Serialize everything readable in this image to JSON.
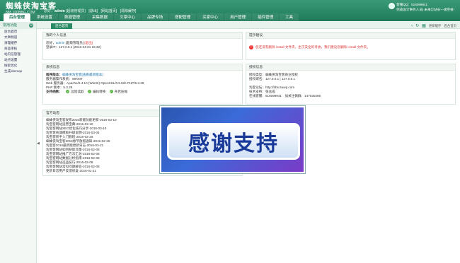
{
  "header": {
    "logo_title": "蜘蛛侠淘宝客",
    "logo_sub": "885.100BBG.COM",
    "welcome_prefix": "您好，",
    "username": "admin",
    "role": "[超级管理员]",
    "logout": "[退出]",
    "home": "[网站首页]",
    "clear_cache": "[清除缓存]"
  },
  "userbox": {
    "line1": "客服QQ：516099941",
    "line2": "完成设计事务人员| 未来订站长一级空投!"
  },
  "nav": {
    "tabs": [
      "后台管理",
      "系统设置",
      "数据管理",
      "采集数据",
      "文章中心",
      "品牌专场",
      "搭配管理",
      "买家中心",
      "用户管理",
      "插件管理",
      "工具"
    ]
  },
  "sidebar": {
    "title": "常用功能",
    "toggle": "⊖",
    "items": [
      "后台首页",
      "文章频道",
      "清理缓存",
      "商品审核",
      "站内信管理",
      "站点设置",
      "搜索优化",
      "生成sitemap"
    ]
  },
  "tabbar": {
    "current": "后台首页",
    "refresh": "更新缓存",
    "fullscreen": "后台首页"
  },
  "panels": {
    "info": {
      "title": "我的个人信息",
      "greeting": "您好，",
      "user": "admin",
      "role": "[超级管理员]",
      "logout": "[退出]",
      "login_ip": "登录IP：127.0.0.1 [2016-04-01 15:32]"
    },
    "tips": {
      "title": "提示建议",
      "warning": "您还没有删除 install 文件夹，出于安全的考虑，我们建议您删除 install 文件夹。"
    },
    "system": {
      "title": "系统信息",
      "program_label": "程序版本：",
      "program_value": "蜘蛛侠淘宝客[查看最新版本]",
      "os": "服务器操作系统：WINNT",
      "web": "Web 服务器：Apache/2.4.10 (Win32) OpenSSL/0.9.8zb PHP/5.3.29",
      "php": "PHP 版本：5.3.29",
      "support_label": "支持函数：",
      "support": [
        "远程读取",
        "编码转换",
        "开启压缩"
      ]
    },
    "auth": {
      "title": "授权信息",
      "type": "授权类型：蜘蛛侠淘宝客商业授权",
      "domain": "授权域名：127.0.0.1 | 127.0.0.1",
      "site": "淘宝论坛：http://bbs.5uwp.com",
      "support": "技术支持：张总成",
      "contact": "在线客服：516099941　加关注微群：147030266"
    },
    "news": {
      "title": "官方动态",
      "items": [
        "蜘蛛侠淘宝客发布2016新版功能更新-2016-03-10",
        "淘宝客网站运营宝典-2016-03-10",
        "淘宝客网站SEO优化技巧分享-2016-03-10",
        "淘宝客商城模板升级说明-2016-03-04",
        "淘宝客新手入门教程-2016-02-26",
        "蜘蛛侠淘宝客2016春节放假通知-2016-02-26",
        "淘宝客2016最新版更新日志-2016-03-21",
        "淘宝客网站如何获取流量-2016-02-08",
        "淘宝客网站推广方法汇总-2016-02-08",
        "淘宝客网站数据分析指南-2016-02-08",
        "淘宝客网站选品技巧-2016-02-08",
        "淘宝客网站常见问题解答-2016-02-08",
        "更新日志用户反馈修复-2016-01-21"
      ]
    }
  },
  "overlay": {
    "text": "感谢支持"
  }
}
